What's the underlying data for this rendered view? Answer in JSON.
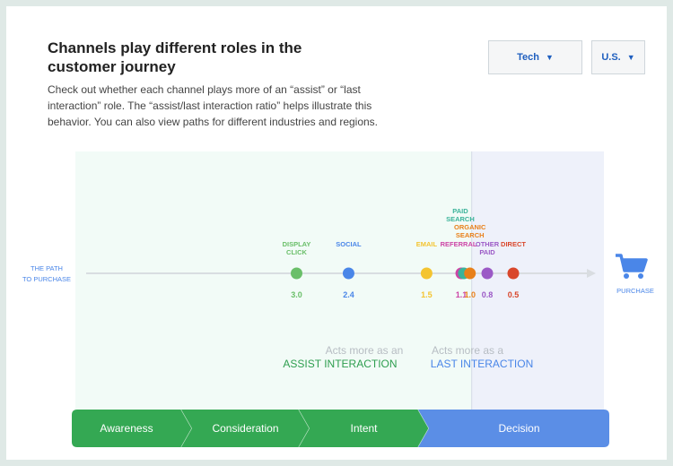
{
  "header": {
    "title": "Channels play different roles in the customer journey",
    "description": "Check out whether each channel plays more of an “assist” or “last interaction” role. The “assist/last interaction ratio” helps illustrate this behavior. You can also view paths for different industries and regions."
  },
  "filters": {
    "industry": {
      "selected": "Tech"
    },
    "region": {
      "selected": "U.S."
    }
  },
  "icons": {
    "dropdown": "triangle-down-icon",
    "purchase": "shopping-cart-icon"
  },
  "colors": {
    "assist_zone": "#f2fbf7",
    "last_zone": "#eef1fa",
    "assist_text": "#2e9e4f",
    "last_text": "#4a86e8",
    "stage_green": "#34a853",
    "stage_blue": "#5b8ee6",
    "cart": "#4a86e8"
  },
  "chart_data": {
    "type": "scatter",
    "title": "",
    "axis_label": "THE PATH TO PURCHASE",
    "end_label": "PURCHASE",
    "threshold": 1.0,
    "x_min": 0.2,
    "x_max": 3.3,
    "points": [
      {
        "label": "DISPLAY CLICK",
        "value": 3.0,
        "value_label": "3.0",
        "color": "#6abf69"
      },
      {
        "label": "SOCIAL",
        "value": 2.4,
        "value_label": "2.4",
        "color": "#4a86e8"
      },
      {
        "label": "EMAIL",
        "value": 1.5,
        "value_label": "1.5",
        "color": "#f4c430"
      },
      {
        "label": "REFERRAL",
        "value": 1.1,
        "value_label": "1.1",
        "color": "#cc44a6"
      },
      {
        "label": "PAID SEARCH",
        "value": 1.07,
        "value_label": "",
        "color": "#3bb39a"
      },
      {
        "label": "ORGANIC SEARCH",
        "value": 1.0,
        "value_label": "1.0",
        "color": "#e8801a"
      },
      {
        "label": "OTHER PAID",
        "value": 0.8,
        "value_label": "0.8",
        "color": "#9b59c6"
      },
      {
        "label": "DIRECT",
        "value": 0.5,
        "value_label": "0.5",
        "color": "#d9472b"
      }
    ],
    "zones": [
      {
        "side": "assist",
        "line1": "Acts more as an",
        "line2": "ASSIST INTERACTION"
      },
      {
        "side": "last",
        "line1": "Acts more as a",
        "line2": "LAST INTERACTION"
      }
    ],
    "stages": [
      "Awareness",
      "Consideration",
      "Intent",
      "Decision"
    ]
  }
}
